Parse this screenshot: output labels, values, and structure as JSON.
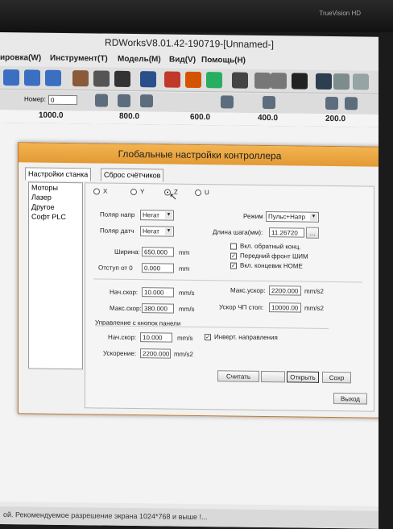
{
  "monitor": {
    "brand": "TrueVision HD"
  },
  "app": {
    "title": "RDWorksV8.01.42-190719-[Unnamed-]",
    "menu": [
      "ировка(W)",
      "Инструмент(T)",
      "Модель(M)",
      "Вид(V)",
      "Помощь(H)"
    ],
    "toolbar2": {
      "number_label": "Номер:",
      "number_value": "0"
    },
    "ruler_ticks": [
      "1000.0",
      "800.0",
      "600.0",
      "400.0",
      "200.0"
    ],
    "status_text": "ой. Рекомендуемое разрешение экрана 1024*768 и выше !..."
  },
  "dialog": {
    "title": "Глобальные настройки контроллера",
    "tabs": [
      "Настройки станка",
      "Сброс счётчиков"
    ],
    "left_list": [
      "Моторы",
      "Лазер",
      "Другое",
      "Софт PLC"
    ],
    "axes": [
      {
        "label": "X",
        "selected": false
      },
      {
        "label": "Y",
        "selected": false
      },
      {
        "label": "Z",
        "selected": true
      },
      {
        "label": "U",
        "selected": false
      }
    ],
    "fields": {
      "polar_dir_label": "Поляр напр",
      "polar_dir_value": "Негат",
      "polar_sensor_label": "Поляр датч",
      "polar_sensor_value": "Негат",
      "mode_label": "Режим",
      "mode_value": "Пульс+Напр",
      "step_len_label": "Длина шага(мм):",
      "step_len_value": "11.26720",
      "step_len_button": "...",
      "width_label": "Ширина:",
      "width_value": "650.000",
      "width_unit": "mm",
      "offset_label": "Отступ от 0",
      "offset_value": "0.000",
      "offset_unit": "mm",
      "chk_reverse": "Вкл. обратный конц.",
      "chk_pwm_front": "Передний фронт ШИМ",
      "chk_home_limit": "Вкл. концевик HOME",
      "start_speed_label": "Нач.скор:",
      "start_speed_value": "10.000",
      "start_speed_unit": "mm/s",
      "max_speed_label": "Макс.скор:",
      "max_speed_value": "380.000",
      "max_speed_unit": "mm/s",
      "max_accel_label": "Макс.ускор:",
      "max_accel_value": "2200.000",
      "max_accel_unit": "mm/s2",
      "jp_accel_label": "Ускор ЧП стоп:",
      "jp_accel_value": "10000.00",
      "jp_accel_unit": "mm/s2",
      "panel_group_label": "Управление с кнопок панели",
      "panel_start_speed_label": "Нач.скор:",
      "panel_start_speed_value": "10.000",
      "panel_start_speed_unit": "mm/s",
      "invert_dir_label": "Инверт. направления",
      "panel_accel_label": "Ускорение:",
      "panel_accel_value": "2200.000",
      "panel_accel_unit": "mm/s2"
    },
    "checks": {
      "reverse": false,
      "pwm_front": true,
      "home_limit": true,
      "invert_dir": true
    },
    "buttons": {
      "read": "Считать",
      "write": "",
      "open": "Открыть",
      "save": "Сохр",
      "exit": "Выход"
    }
  }
}
